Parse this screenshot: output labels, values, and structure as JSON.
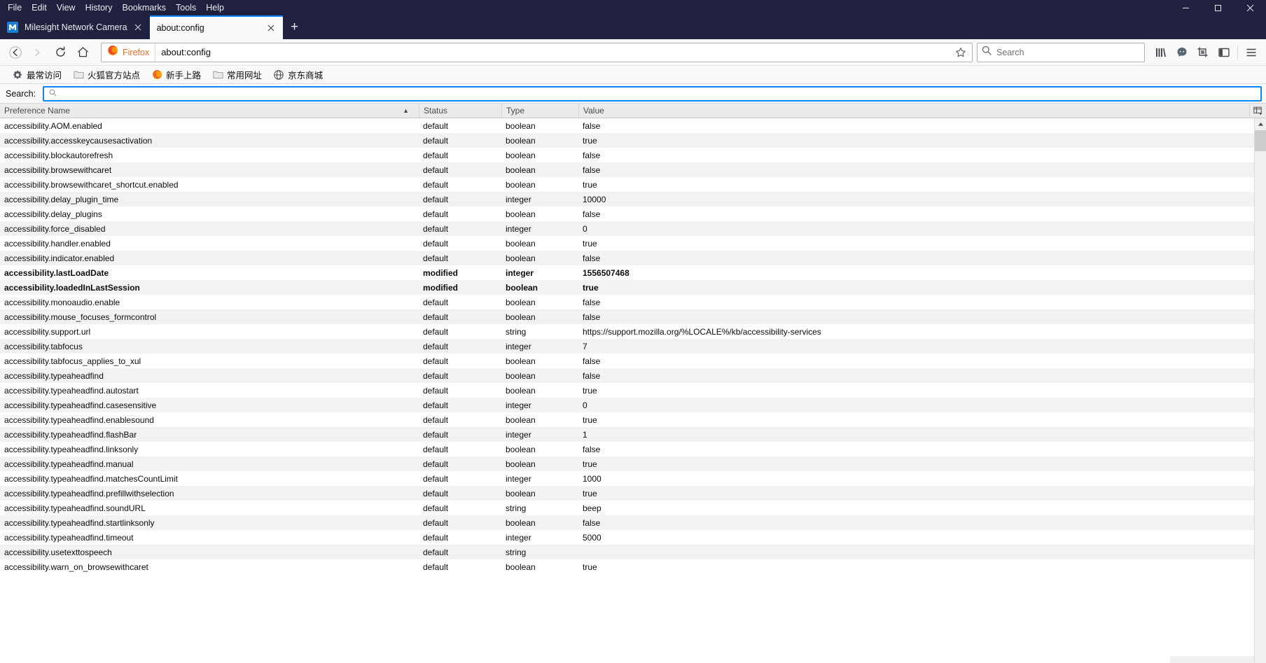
{
  "window": {
    "menu": [
      "File",
      "Edit",
      "View",
      "History",
      "Bookmarks",
      "Tools",
      "Help"
    ],
    "controls": {
      "minimize": "–",
      "maximize": "▢",
      "close": "✕"
    }
  },
  "tabs": [
    {
      "title": "Milesight Network Camera",
      "favicon": "milesight-logo-icon",
      "active": false,
      "close": "✕"
    },
    {
      "title": "about:config",
      "favicon": "none",
      "active": true,
      "close": "✕"
    }
  ],
  "newtab_label": "+",
  "toolbar": {
    "back": "back-arrow-icon",
    "forward": "forward-arrow-icon",
    "reload": "reload-icon",
    "home": "home-icon",
    "identity_label": "Firefox",
    "url_value": "about:config",
    "bookmark_star": "star-icon",
    "search_placeholder": "Search",
    "icons": [
      "library-icon",
      "pocket-icon",
      "screenshot-icon",
      "sidebar-icon",
      "menu-icon"
    ]
  },
  "bookmarks": [
    {
      "label": "最常访问",
      "icon": "gear-icon"
    },
    {
      "label": "火狐官方站点",
      "icon": "folder-icon"
    },
    {
      "label": "新手上路",
      "icon": "firefox-icon"
    },
    {
      "label": "常用网址",
      "icon": "folder-icon"
    },
    {
      "label": "京东商城",
      "icon": "globe-icon"
    }
  ],
  "prefs_search": {
    "label": "Search:",
    "value": "",
    "icon": "magnifier-icon",
    "focused": true
  },
  "table": {
    "columns": [
      "Preference Name",
      "Status",
      "Type",
      "Value"
    ],
    "sort_column": "Preference Name",
    "sort_direction": "ascending",
    "sort_indicator": "▲",
    "column_picker_icon": "column-picker-icon",
    "rows": [
      {
        "name": "accessibility.AOM.enabled",
        "status": "default",
        "type": "boolean",
        "value": "false",
        "modified": false
      },
      {
        "name": "accessibility.accesskeycausesactivation",
        "status": "default",
        "type": "boolean",
        "value": "true",
        "modified": false
      },
      {
        "name": "accessibility.blockautorefresh",
        "status": "default",
        "type": "boolean",
        "value": "false",
        "modified": false
      },
      {
        "name": "accessibility.browsewithcaret",
        "status": "default",
        "type": "boolean",
        "value": "false",
        "modified": false
      },
      {
        "name": "accessibility.browsewithcaret_shortcut.enabled",
        "status": "default",
        "type": "boolean",
        "value": "true",
        "modified": false
      },
      {
        "name": "accessibility.delay_plugin_time",
        "status": "default",
        "type": "integer",
        "value": "10000",
        "modified": false
      },
      {
        "name": "accessibility.delay_plugins",
        "status": "default",
        "type": "boolean",
        "value": "false",
        "modified": false
      },
      {
        "name": "accessibility.force_disabled",
        "status": "default",
        "type": "integer",
        "value": "0",
        "modified": false
      },
      {
        "name": "accessibility.handler.enabled",
        "status": "default",
        "type": "boolean",
        "value": "true",
        "modified": false
      },
      {
        "name": "accessibility.indicator.enabled",
        "status": "default",
        "type": "boolean",
        "value": "false",
        "modified": false
      },
      {
        "name": "accessibility.lastLoadDate",
        "status": "modified",
        "type": "integer",
        "value": "1556507468",
        "modified": true
      },
      {
        "name": "accessibility.loadedInLastSession",
        "status": "modified",
        "type": "boolean",
        "value": "true",
        "modified": true
      },
      {
        "name": "accessibility.monoaudio.enable",
        "status": "default",
        "type": "boolean",
        "value": "false",
        "modified": false
      },
      {
        "name": "accessibility.mouse_focuses_formcontrol",
        "status": "default",
        "type": "boolean",
        "value": "false",
        "modified": false
      },
      {
        "name": "accessibility.support.url",
        "status": "default",
        "type": "string",
        "value": "https://support.mozilla.org/%LOCALE%/kb/accessibility-services",
        "modified": false
      },
      {
        "name": "accessibility.tabfocus",
        "status": "default",
        "type": "integer",
        "value": "7",
        "modified": false
      },
      {
        "name": "accessibility.tabfocus_applies_to_xul",
        "status": "default",
        "type": "boolean",
        "value": "false",
        "modified": false
      },
      {
        "name": "accessibility.typeaheadfind",
        "status": "default",
        "type": "boolean",
        "value": "false",
        "modified": false
      },
      {
        "name": "accessibility.typeaheadfind.autostart",
        "status": "default",
        "type": "boolean",
        "value": "true",
        "modified": false
      },
      {
        "name": "accessibility.typeaheadfind.casesensitive",
        "status": "default",
        "type": "integer",
        "value": "0",
        "modified": false
      },
      {
        "name": "accessibility.typeaheadfind.enablesound",
        "status": "default",
        "type": "boolean",
        "value": "true",
        "modified": false
      },
      {
        "name": "accessibility.typeaheadfind.flashBar",
        "status": "default",
        "type": "integer",
        "value": "1",
        "modified": false
      },
      {
        "name": "accessibility.typeaheadfind.linksonly",
        "status": "default",
        "type": "boolean",
        "value": "false",
        "modified": false
      },
      {
        "name": "accessibility.typeaheadfind.manual",
        "status": "default",
        "type": "boolean",
        "value": "true",
        "modified": false
      },
      {
        "name": "accessibility.typeaheadfind.matchesCountLimit",
        "status": "default",
        "type": "integer",
        "value": "1000",
        "modified": false
      },
      {
        "name": "accessibility.typeaheadfind.prefillwithselection",
        "status": "default",
        "type": "boolean",
        "value": "true",
        "modified": false
      },
      {
        "name": "accessibility.typeaheadfind.soundURL",
        "status": "default",
        "type": "string",
        "value": "beep",
        "modified": false
      },
      {
        "name": "accessibility.typeaheadfind.startlinksonly",
        "status": "default",
        "type": "boolean",
        "value": "false",
        "modified": false
      },
      {
        "name": "accessibility.typeaheadfind.timeout",
        "status": "default",
        "type": "integer",
        "value": "5000",
        "modified": false
      },
      {
        "name": "accessibility.usetexttospeech",
        "status": "default",
        "type": "string",
        "value": "",
        "modified": false
      },
      {
        "name": "accessibility.warn_on_browsewithcaret",
        "status": "default",
        "type": "boolean",
        "value": "true",
        "modified": false
      }
    ]
  },
  "colors": {
    "chrome_dark": "#20213f",
    "accent_blue": "#0a84ff",
    "toolbar_bg": "#f9f9fa",
    "row_alt": "#f2f2f2",
    "firefox_orange": "#e86c28"
  }
}
